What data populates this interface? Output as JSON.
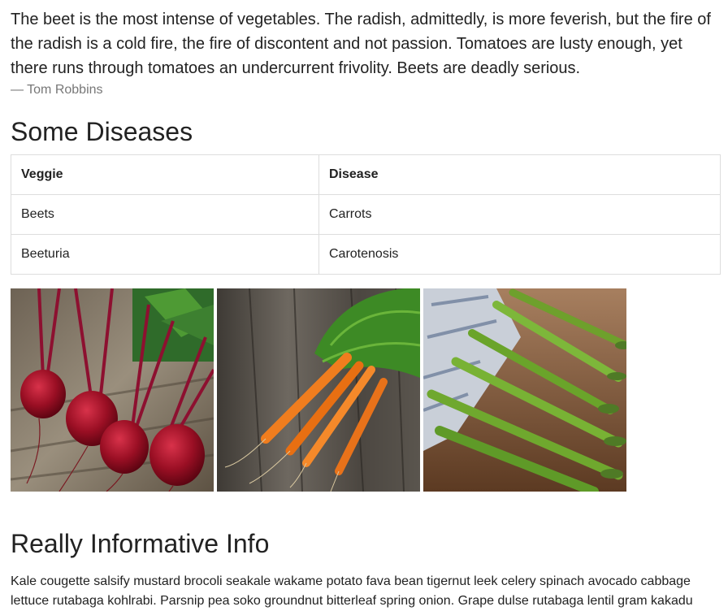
{
  "quote": {
    "text": "The beet is the most intense of vegetables. The radish, admittedly, is more feverish, but the fire of the radish is a cold fire, the fire of discontent and not passion. Tomatoes are lusty enough, yet there runs through tomatoes an undercurrent frivolity. Beets are deadly serious.",
    "attribution": "— Tom Robbins"
  },
  "diseases": {
    "heading": "Some Diseases",
    "columns": [
      "Veggie",
      "Disease"
    ],
    "rows": [
      [
        "Beets",
        "Carrots"
      ],
      [
        "Beeturia",
        "Carotenosis"
      ]
    ]
  },
  "images": [
    {
      "icon": "beets-photo"
    },
    {
      "icon": "carrots-photo"
    },
    {
      "icon": "asparagus-photo"
    }
  ],
  "info": {
    "heading": "Really Informative Info",
    "paragraph": "Kale cougette salsify mustard brocoli seakale wakame potato fava bean tigernut leek celery spinach avocado cabbage lettuce rutabaga kohlrabi. Parsnip pea soko groundnut bitterleaf spring onion. Grape dulse rutabaga lentil gram kakadu"
  }
}
